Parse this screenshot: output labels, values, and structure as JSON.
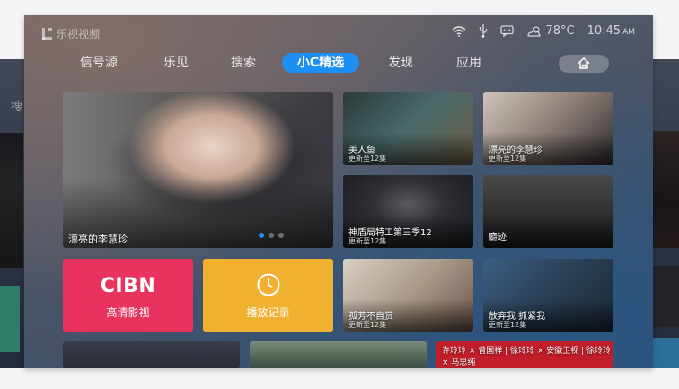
{
  "side_left": {
    "partial_nav": "搜"
  },
  "status_bar": {
    "logo_text": "乐视视频",
    "temperature": "78°C",
    "time": "10:45",
    "ampm": "AM",
    "icons": [
      "wifi-icon",
      "usb-icon",
      "message-icon",
      "weather-icon"
    ]
  },
  "nav": {
    "items": [
      {
        "label": "信号源"
      },
      {
        "label": "乐见"
      },
      {
        "label": "搜索"
      },
      {
        "label": "小C精选",
        "active": true
      },
      {
        "label": "发现"
      },
      {
        "label": "应用"
      }
    ],
    "home_icon": "home-icon"
  },
  "accent_color": "#1e8ff2",
  "featured": {
    "title": "漂亮的李慧珍",
    "carousel_dots": 3,
    "active_dot": 1
  },
  "tiles": [
    {
      "title": "美人鱼",
      "subtitle": "更新至12集"
    },
    {
      "title": "漂亮的李慧珍",
      "subtitle": "更新至12集"
    },
    {
      "title": "神盾局特工第三季12",
      "subtitle": "更新至12集"
    },
    {
      "title": "麝迹",
      "subtitle": ""
    },
    {
      "title": "孤芳不自赏",
      "subtitle": "更新至12集"
    },
    {
      "title": "放弃我 抓紧我",
      "subtitle": "更新至12集"
    }
  ],
  "apps": [
    {
      "logo": "CIBN",
      "label": "高清影视",
      "color": "#e8335f"
    },
    {
      "label": "播放记录",
      "icon": "clock-icon",
      "color": "#f0b030"
    }
  ],
  "bottom_row": [
    {
      "text": ""
    },
    {
      "text": ""
    },
    {
      "text": "许玲玲 × 曾国祥 | 徐玲玲 × 安徽卫视 | 徐玲玲 × 马思纯"
    }
  ]
}
